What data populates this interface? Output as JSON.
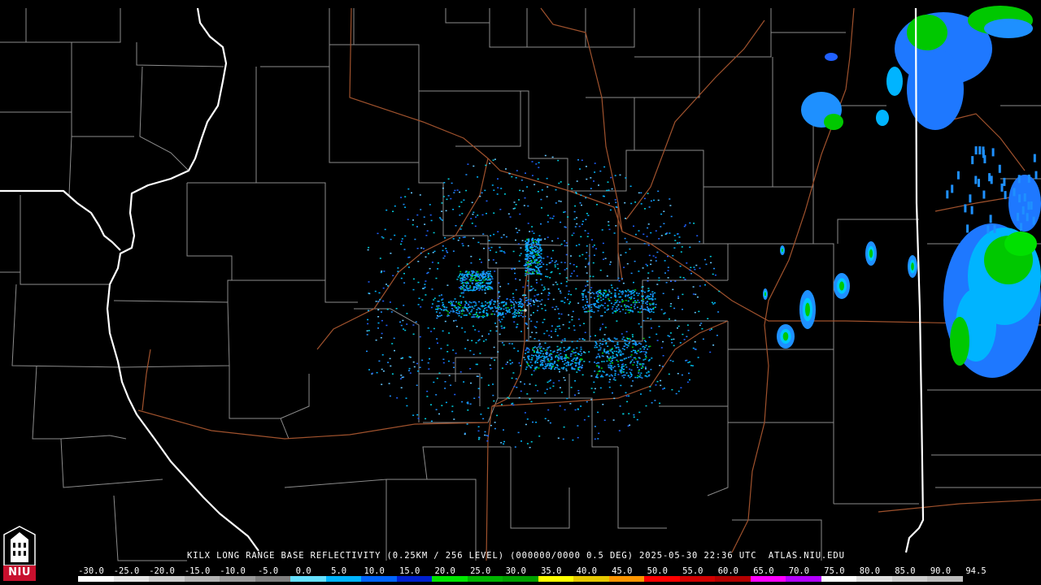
{
  "product": {
    "caption": "KILX LONG RANGE BASE REFLECTIVITY (0.25KM / 256 LEVEL) (000000/0000 0.5 DEG) 2025-05-30 22:36 UTC  ATLAS.NIU.EDU"
  },
  "logo": {
    "text": "NIU",
    "color": "#c8102e"
  },
  "colors": {
    "background": "#000000",
    "county_lines": "#9a9a9a",
    "state_lines": "#ffffff",
    "highways": "#a0522d"
  },
  "color_scale": {
    "labels": [
      "-30.0",
      "-25.0",
      "-20.0",
      "-15.0",
      "-10.0",
      "-5.0",
      "0.0",
      "5.0",
      "10.0",
      "15.0",
      "20.0",
      "25.0",
      "30.0",
      "35.0",
      "40.0",
      "45.0",
      "50.0",
      "55.0",
      "60.0",
      "65.0",
      "70.0",
      "75.0",
      "80.0",
      "85.0",
      "90.0",
      "94.5"
    ],
    "colors": [
      "#ffffff",
      "#e6e6e6",
      "#cccccc",
      "#b3b3b3",
      "#999999",
      "#7f7f7f",
      "#66e0ff",
      "#00b4ff",
      "#0064ff",
      "#0020d0",
      "#00e600",
      "#00b400",
      "#00a000",
      "#ffff00",
      "#e6c800",
      "#ff9600",
      "#ff0000",
      "#d20000",
      "#b40000",
      "#ff00ff",
      "#b400ff",
      "#ffffff",
      "#e0e0e0",
      "#cccccc",
      "#bbbbbb"
    ]
  },
  "echoes": [
    {
      "name": "radar-site-clutter",
      "dbz": 5
    },
    {
      "name": "western-storms-line",
      "dbz": 30
    },
    {
      "name": "eastern-storm-complex",
      "dbz": 30
    },
    {
      "name": "northeast-storm-cluster",
      "dbz": 25
    }
  ]
}
